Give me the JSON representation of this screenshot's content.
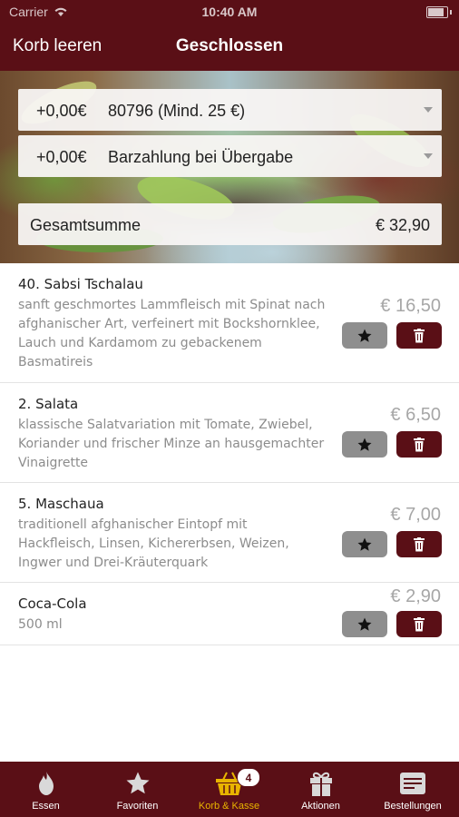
{
  "status": {
    "carrier": "Carrier",
    "time": "10:40 AM"
  },
  "nav": {
    "left_button": "Korb leeren",
    "title": "Geschlossen"
  },
  "order": {
    "delivery": {
      "surcharge": "+0,00€",
      "value": "80796 (Mind. 25 €)"
    },
    "payment": {
      "surcharge": "+0,00€",
      "value": "Barzahlung bei Übergabe"
    },
    "total": {
      "label": "Gesamtsumme",
      "amount": "€ 32,90"
    }
  },
  "items": [
    {
      "name": "40. Sabsi Tschalau",
      "desc": "sanft geschmortes Lammfleisch mit Spinat nach afghanischer Art, verfeinert mit Bockshornklee, Lauch und Kardamom zu gebackenem Basmatireis",
      "price": "€ 16,50"
    },
    {
      "name": "2. Salata",
      "desc": "klassische Salatvariation mit Tomate, Zwiebel, Koriander und frischer Minze an hausgemachter Vinaigrette",
      "price": "€ 6,50"
    },
    {
      "name": "5. Maschaua",
      "desc": "traditionell afghanischer Eintopf mit Hackfleisch, Linsen, Kichererbsen, Weizen, Ingwer und Drei-Kräuterquark",
      "price": "€ 7,00"
    },
    {
      "name": "Coca-Cola",
      "desc": "500 ml",
      "price": "€ 2,90"
    }
  ],
  "tabs": [
    {
      "label": "Essen",
      "icon": "flame-icon"
    },
    {
      "label": "Favoriten",
      "icon": "star-icon"
    },
    {
      "label": "Korb & Kasse",
      "icon": "basket-icon",
      "badge": "4"
    },
    {
      "label": "Aktionen",
      "icon": "gift-icon"
    },
    {
      "label": "Bestellungen",
      "icon": "orders-icon"
    }
  ],
  "colors": {
    "brand": "#5a0f16",
    "active_tab": "#e8b400",
    "star_button": "#8e8e8e"
  }
}
